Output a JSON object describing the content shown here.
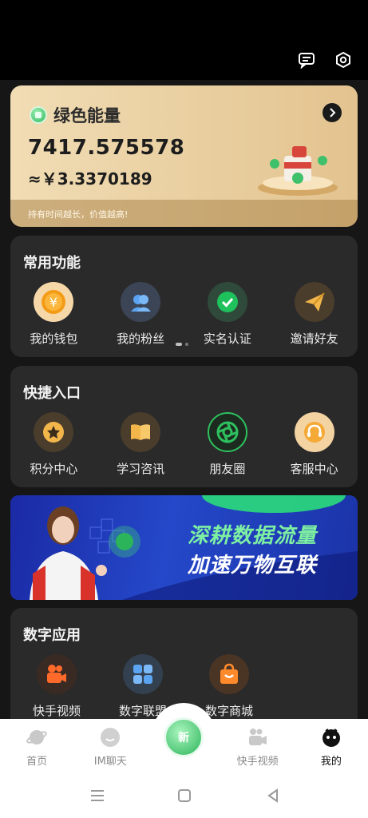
{
  "energy": {
    "title": "绿色能量",
    "amount": "7417.575578",
    "cny": "≈￥3.3370189",
    "footer": "持有时间越长，价值越高!"
  },
  "common": {
    "title": "常用功能",
    "items": [
      {
        "label": "我的钱包",
        "icon": "wallet-icon"
      },
      {
        "label": "我的粉丝",
        "icon": "fans-icon"
      },
      {
        "label": "实名认证",
        "icon": "verify-icon"
      },
      {
        "label": "邀请好友",
        "icon": "invite-icon"
      }
    ]
  },
  "quick": {
    "title": "快捷入口",
    "items": [
      {
        "label": "积分中心",
        "icon": "star-icon"
      },
      {
        "label": "学习咨讯",
        "icon": "book-icon"
      },
      {
        "label": "朋友圈",
        "icon": "moments-icon"
      },
      {
        "label": "客服中心",
        "icon": "headset-icon"
      }
    ]
  },
  "banner": {
    "line1": "深耕数据流量",
    "line2": "加速万物互联"
  },
  "digital": {
    "title": "数字应用",
    "items": [
      {
        "label": "快手视频",
        "icon": "video-icon"
      },
      {
        "label": "数字联盟",
        "icon": "apps-icon"
      },
      {
        "label": "数字商城",
        "icon": "shop-icon"
      }
    ]
  },
  "nav": {
    "items": [
      {
        "label": "首页",
        "icon": "planet-icon"
      },
      {
        "label": "IM聊天",
        "icon": "chat-icon"
      },
      {
        "label": "",
        "icon": "center-coin-icon"
      },
      {
        "label": "快手视频",
        "icon": "video-icon"
      },
      {
        "label": "我的",
        "icon": "profile-icon"
      }
    ],
    "center_badge": "新"
  },
  "colors": {
    "accent_green": "#2cb45b",
    "card_bg": "#2a2a2a",
    "gold": "#e9cfa0"
  }
}
